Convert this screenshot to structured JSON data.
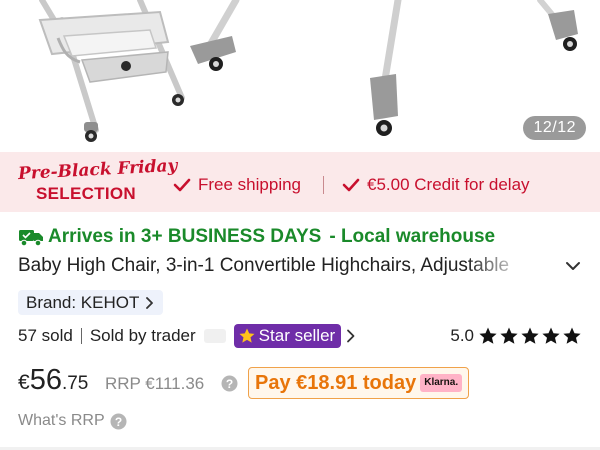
{
  "gallery": {
    "counter": "12/12",
    "image_alt": "Baby high chair product photo"
  },
  "promo": {
    "badge_line1": "Pre-Black Friday",
    "badge_line2": "SELECTION",
    "item1": "Free shipping",
    "item2": "€5.00 Credit for delay",
    "icon": "check-icon",
    "accent_color": "#c8102e",
    "background_color": "#fbe9ea"
  },
  "delivery": {
    "icon": "truck-icon",
    "main": "Arrives in 3+ BUSINESS DAYS",
    "sub": "- Local warehouse",
    "color": "#1a8a2a"
  },
  "product": {
    "title": "Baby High Chair, 3-in-1 Convertible Highchairs, Adjustable",
    "expand_icon": "chevron-down-icon",
    "brand_label": "Brand: KEHOT"
  },
  "seller": {
    "sold": "57 sold",
    "sold_by": "Sold by trader",
    "badge": "Star seller",
    "badge_color": "#6f2da8",
    "rating": "5.0",
    "stars": 5
  },
  "price": {
    "currency": "€",
    "integer": "56",
    "decimal": ".75",
    "rrp": "RRP €111.36",
    "pay_today": "Pay €18.91 today",
    "klarna_label": "Klarna.",
    "pay_color": "#e8750a",
    "whats_rrp": "What's RRP"
  }
}
